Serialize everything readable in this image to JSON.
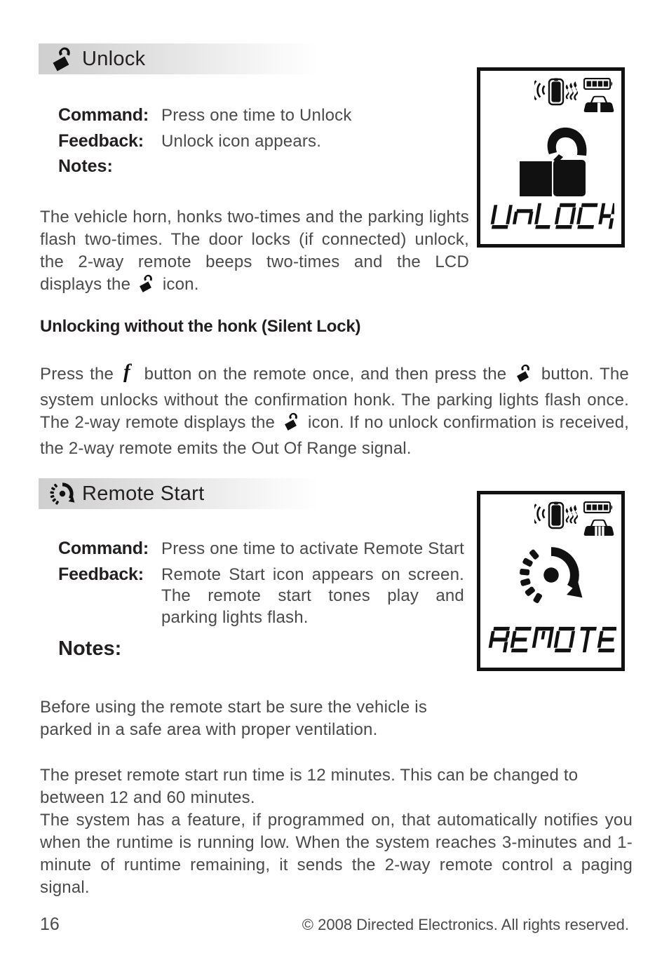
{
  "document": {
    "page_number": "16",
    "copyright": "© 2008 Directed Electronics. All rights reserved."
  },
  "sections": [
    {
      "id": "unlock",
      "icon": "unlock-padlock-icon",
      "title": "Unlock",
      "command_label": "Command:",
      "command_value": "Press one time to Unlock",
      "feedback_label": "Feedback:",
      "feedback_value": "Unlock icon appears.",
      "notes_label": "Notes:",
      "notes_body_1": "The vehicle horn, honks two-times and the parking lights flash two-times. The door locks (if connected) unlock, the 2-way remote beeps two-times and the LCD displays the",
      "notes_body_1_tail": "icon.",
      "subheading": "Unlocking without the honk (Silent Lock)",
      "silent_text_1": "Press the",
      "silent_text_2": "button on the remote once, and then press the",
      "silent_text_3": "button. The system unlocks without the confirmation honk. The parking lights flash once. The 2-way remote displays the",
      "silent_text_4": "icon. If no unlock confirmation is received, the 2-way remote emits the Out Of Range signal.",
      "lcd": {
        "remote_icon": "remote-fob-signal-icon",
        "battery_icon": "battery-full-icon",
        "car_icon": "car-front-icon",
        "center_icon": "unlock-padlock-large-icon",
        "word": "UNLOCK"
      }
    },
    {
      "id": "remote-start",
      "icon": "remote-start-dial-icon",
      "title": "Remote Start",
      "command_label": "Command:",
      "command_value": "Press one time to activate Remote Start",
      "feedback_label": "Feedback:",
      "feedback_value": "Remote Start icon appears on screen. The remote start tones play and parking lights flash.",
      "notes_label": "Notes:",
      "notes_body_1": "Before using the remote start be sure the vehicle is parked in a safe area with proper ventilation.",
      "notes_body_2": "The preset remote start run time is 12 minutes. This can be changed to between 12 and 60 minutes.",
      "notes_body_3": "The system has a feature, if programmed on, that automatically notifies you when the runtime is running low. When the system reaches 3-minutes and 1-minute of runtime remaining, it sends the 2-way remote control a paging signal.",
      "lcd": {
        "remote_icon": "remote-fob-signal-icon",
        "battery_icon": "battery-full-icon",
        "car_icon": "car-front-running-icon",
        "center_icon": "remote-start-dial-large-icon",
        "word": "REMOTE"
      }
    }
  ],
  "colors": {
    "ink": "#231f20",
    "body_text": "#4a4a4a",
    "header_gradient_start": "#cfcfcf",
    "header_gradient_end": "#ffffff",
    "lcd_border": "#111111"
  }
}
